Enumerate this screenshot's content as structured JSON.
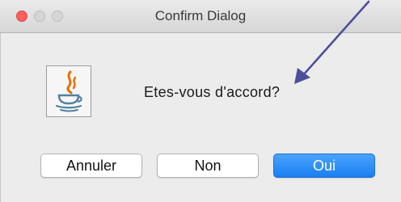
{
  "window": {
    "title": "Confirm Dialog"
  },
  "dialog": {
    "icon": "java-coffee-cup-icon",
    "message": "Etes-vous d'accord?"
  },
  "buttons": {
    "cancel": "Annuler",
    "no": "Non",
    "yes": "Oui"
  },
  "annotation": {
    "icon": "pointer-arrow-icon",
    "color": "#4c4f9a"
  },
  "colors": {
    "primary_button": "#1a7ff0",
    "close_button": "#fc605c"
  }
}
